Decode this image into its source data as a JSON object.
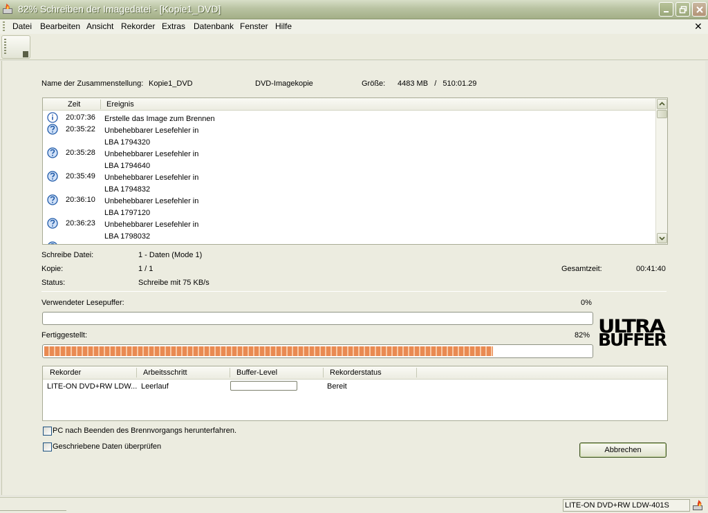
{
  "window": {
    "title": "82% Schreiben der Imagedatei - [Kopie1_DVD]"
  },
  "menu": {
    "items": [
      "Datei",
      "Bearbeiten",
      "Ansicht",
      "Rekorder",
      "Extras",
      "Datenbank",
      "Fenster",
      "Hilfe"
    ],
    "close_glyph": "✕"
  },
  "compilation": {
    "name_label": "Name der Zusammenstellung:",
    "name_value": "Kopie1_DVD",
    "type": "DVD-Imagekopie",
    "size_label": "Größe:",
    "size_value": "4483 MB   /   510:01.29"
  },
  "event_log": {
    "columns": [
      "Zeit",
      "Ereignis"
    ],
    "rows": [
      {
        "icon": "info-icon",
        "time": "20:07:36",
        "text": "Erstelle das Image zum Brennen"
      },
      {
        "icon": "warning-icon",
        "time": "20:35:22",
        "text": "Unbehebbarer Lesefehler in\nLBA 1794320"
      },
      {
        "icon": "warning-icon",
        "time": "20:35:28",
        "text": "Unbehebbarer Lesefehler in\nLBA 1794640"
      },
      {
        "icon": "warning-icon",
        "time": "20:35:49",
        "text": "Unbehebbarer Lesefehler in\nLBA 1794832"
      },
      {
        "icon": "warning-icon",
        "time": "20:36:10",
        "text": "Unbehebbarer Lesefehler in\nLBA 1797120"
      },
      {
        "icon": "warning-icon",
        "time": "20:36:23",
        "text": "Unbehebbarer Lesefehler in\nLBA 1798032"
      },
      {
        "icon": "warning-icon",
        "time": "",
        "text": ""
      }
    ]
  },
  "details": {
    "file_label": "Schreibe Datei:",
    "file_value": "1 - Daten (Mode 1)",
    "copy_label": "Kopie:",
    "copy_value": "1 / 1",
    "total_time_label": "Gesamtzeit:",
    "total_time_value": "00:41:40",
    "status_label": "Status:",
    "status_value": "Schreibe mit 75 KB/s"
  },
  "buffer": {
    "label": "Verwendeter Lesepuffer:",
    "percent_text": "0%",
    "fraction": 0
  },
  "progress": {
    "label": "Fertiggestellt:",
    "percent_text": "82%",
    "fraction": 0.82
  },
  "logo": {
    "line1": "ULTRA",
    "line2": "BUFFER"
  },
  "recorder_table": {
    "columns": [
      "Rekorder",
      "Arbeitsschritt",
      "Buffer-Level",
      "Rekorderstatus"
    ],
    "rows": [
      {
        "recorder": "LITE-ON DVD+RW LDW...",
        "step": "Leerlauf",
        "buffer_fraction": 0,
        "status": "Bereit"
      }
    ]
  },
  "options": {
    "shutdown_label": "PC nach Beenden des Brennvorgangs herunterfahren.",
    "shutdown_checked": false,
    "verify_label": "Geschriebene Daten überprüfen",
    "verify_checked": false
  },
  "buttons": {
    "cancel": "Abbrechen"
  },
  "statusbar": {
    "recorder": "LITE-ON  DVD+RW LDW-401S"
  },
  "colors": {
    "progress_accent": "#e98a52",
    "title_bar": "#b9c3a2"
  }
}
